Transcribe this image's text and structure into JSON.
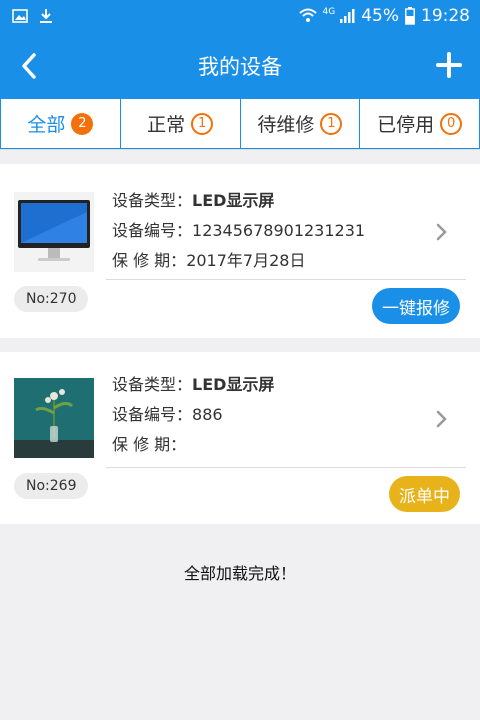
{
  "status": {
    "network": "4G",
    "battery": "45%",
    "time": "19:28"
  },
  "header": {
    "title": "我的设备"
  },
  "tabs": [
    {
      "label": "全部",
      "count": "2"
    },
    {
      "label": "正常",
      "count": "1"
    },
    {
      "label": "待维修",
      "count": "1"
    },
    {
      "label": "已停用",
      "count": "0"
    }
  ],
  "devices": [
    {
      "type_label": "设备类型：",
      "type_value": "LED显示屏",
      "serial_label": "设备编号：",
      "serial_value": "12345678901231231",
      "warranty_label": "保 修 期：",
      "warranty_value": "2017年7月28日",
      "no": "No:270",
      "action": "一键报修"
    },
    {
      "type_label": "设备类型：",
      "type_value": "LED显示屏",
      "serial_label": "设备编号：",
      "serial_value": "886",
      "warranty_label": "保 修 期：",
      "warranty_value": "",
      "no": "No:269",
      "action": "派单中"
    }
  ],
  "footer": {
    "note": "全部加载完成！"
  },
  "colors": {
    "primary": "#1a8fe8",
    "badge": "#f5700a",
    "pending": "#e8b21a"
  }
}
